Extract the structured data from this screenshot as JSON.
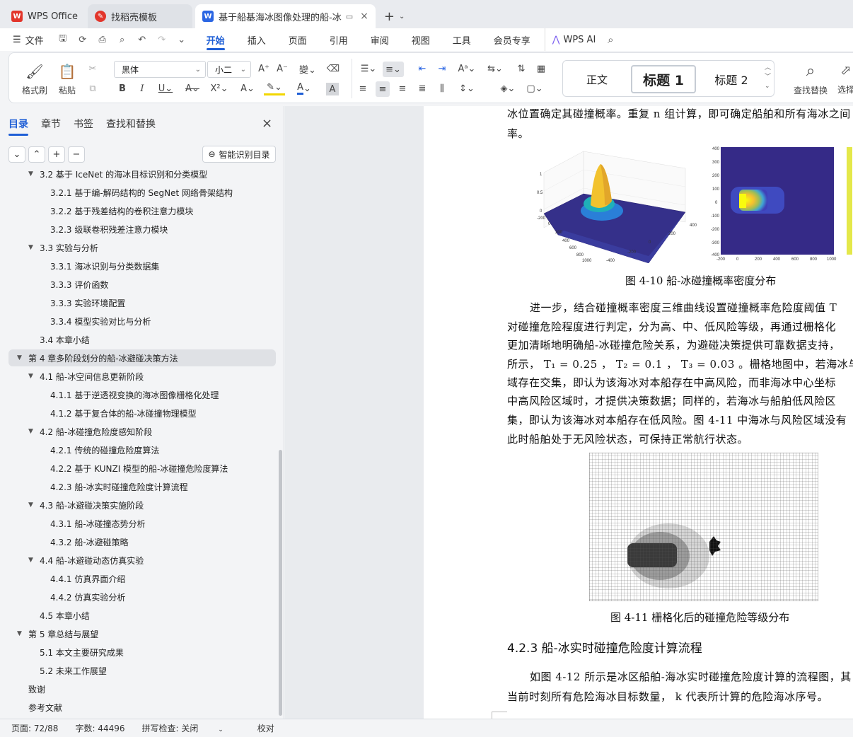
{
  "titlebar": {
    "tabs": [
      {
        "label": "WPS Office",
        "icon": "wps-logo-icon"
      },
      {
        "label": "找稻壳模板",
        "icon": "docer-icon"
      },
      {
        "label": "基于船基海冰图像处理的船-冰",
        "icon": "word-doc-icon"
      }
    ],
    "new_tab": "+"
  },
  "menubar": {
    "file": "文件",
    "items": [
      "开始",
      "插入",
      "页面",
      "引用",
      "审阅",
      "视图",
      "工具",
      "会员专享"
    ],
    "ai": "WPS AI"
  },
  "ribbon": {
    "format_painter": "格式刷",
    "paste": "粘贴",
    "font_name": "黑体",
    "font_size": "小二",
    "styles": [
      "正文",
      "标题 1",
      "标题 2"
    ],
    "find_replace": "查找替换",
    "select": "选择"
  },
  "sidebar": {
    "tabs": [
      "目录",
      "章节",
      "书签",
      "查找和替换"
    ],
    "smart_toc": "智能识别目录",
    "toc": [
      {
        "level": 2,
        "text": "3.2  基于 IceNet 的海冰目标识别和分类模型",
        "expanded": true
      },
      {
        "level": 3,
        "text": "3.2.1  基于编-解码结构的 SegNet 网络骨架结构"
      },
      {
        "level": 3,
        "text": "3.2.2  基于残差结构的卷积注意力模块"
      },
      {
        "level": 3,
        "text": "3.2.3  级联卷积残差注意力模块"
      },
      {
        "level": 2,
        "text": "3.3  实验与分析",
        "expanded": true
      },
      {
        "level": 3,
        "text": "3.3.1  海冰识别与分类数据集"
      },
      {
        "level": 3,
        "text": "3.3.3  评价函数"
      },
      {
        "level": 3,
        "text": "3.3.3  实验环境配置"
      },
      {
        "level": 3,
        "text": "3.3.4  模型实验对比与分析"
      },
      {
        "level": 2,
        "text": "3.4  本章小结"
      },
      {
        "level": 1,
        "text": "第 4 章多阶段划分的船-冰避碰决策方法",
        "expanded": true,
        "selected": true
      },
      {
        "level": 2,
        "text": "4.1  船-冰空间信息更新阶段",
        "expanded": true
      },
      {
        "level": 3,
        "text": "4.1.1  基于逆透视变换的海冰图像栅格化处理"
      },
      {
        "level": 3,
        "text": "4.1.2  基于复合体的船-冰碰撞物理模型"
      },
      {
        "level": 2,
        "text": "4.2  船-冰碰撞危险度感知阶段",
        "expanded": true
      },
      {
        "level": 3,
        "text": "4.2.1  传统的碰撞危险度算法"
      },
      {
        "level": 3,
        "text": "4.2.2  基于 KUNZI 模型的船-冰碰撞危险度算法"
      },
      {
        "level": 3,
        "text": "4.2.3  船-冰实时碰撞危险度计算流程"
      },
      {
        "level": 2,
        "text": "4.3  船-冰避碰决策实施阶段",
        "expanded": true
      },
      {
        "level": 3,
        "text": "4.3.1  船-冰碰撞态势分析"
      },
      {
        "level": 3,
        "text": "4.3.2  船-冰避碰策略"
      },
      {
        "level": 2,
        "text": "4.4  船-冰避碰动态仿真实验",
        "expanded": true
      },
      {
        "level": 3,
        "text": "4.4.1  仿真界面介绍"
      },
      {
        "level": 3,
        "text": "4.4.2  仿真实验分析"
      },
      {
        "level": 2,
        "text": "4.5  本章小结"
      },
      {
        "level": 1,
        "text": "第 5 章总结与展望",
        "expanded": true
      },
      {
        "level": 2,
        "text": "5.1  本文主要研究成果"
      },
      {
        "level": 2,
        "text": "5.2  未来工作展望"
      },
      {
        "level": 1,
        "text": "致谢"
      },
      {
        "level": 1,
        "text": "参考文献"
      }
    ]
  },
  "document": {
    "lines": [
      "冰位置确定其碰撞概率。重复 n 组计算，即可确定船舶和所有海冰之间",
      "率。"
    ],
    "fig10_caption": "图 4-10  船-冰碰撞概率密度分布",
    "fig10_ticks": {
      "z": [
        "1",
        "0.5",
        "0"
      ],
      "x": [
        "-200",
        "0",
        "200",
        "400",
        "600",
        "800",
        "1000"
      ],
      "y": [
        "-400",
        "-200",
        "0",
        "200",
        "400"
      ],
      "heat_y": [
        "400",
        "300",
        "200",
        "100",
        "0",
        "-100",
        "-200",
        "-300",
        "-400"
      ],
      "heat_x": [
        "-200",
        "0",
        "200",
        "400",
        "600",
        "800",
        "1000"
      ]
    },
    "para2": [
      "进一步，结合碰撞概率密度三维曲线设置碰撞概率危险度阈值 T",
      "对碰撞危险程度进行判定，分为高、中、低风险等级，再通过栅格化",
      "更加清晰地明确船-冰碰撞危险关系，为避碰决策提供可靠数据支持，",
      "所示，  T₁ = 0.25 ，  T₂ = 0.1 ，  T₃ = 0.03 。栅格地图中，若海冰与船舶中",
      "域存在交集，即认为该海冰对本船存在中高风险，而非海冰中心坐标",
      "中高风险区域时，才提供决策数据；同样的，若海冰与船舶低风险区",
      "集，即认为该海冰对本船存在低风险。图 4-11 中海冰与风险区域没有",
      "此时船舶处于无风险状态，可保持正常航行状态。"
    ],
    "fig11_caption": "图 4-11  栅格化后的碰撞危险等级分布",
    "heading": "4.2.3  船-冰实时碰撞危险度计算流程",
    "para3": [
      "如图 4-12 所示是冰区船舶-海冰实时碰撞危险度计算的流程图，其",
      "当前时刻所有危险海冰目标数量， k 代表所计算的危险海冰序号。"
    ]
  },
  "statusbar": {
    "page": "页面: 72/88",
    "words": "字数: 44496",
    "spell": "拼写检查: 关闭",
    "proof": "校对"
  },
  "colors": {
    "accent": "#1f5fd6",
    "wps_red": "#e2352b",
    "parula_low": "#352a87",
    "parula_high": "#f9fb0e"
  }
}
